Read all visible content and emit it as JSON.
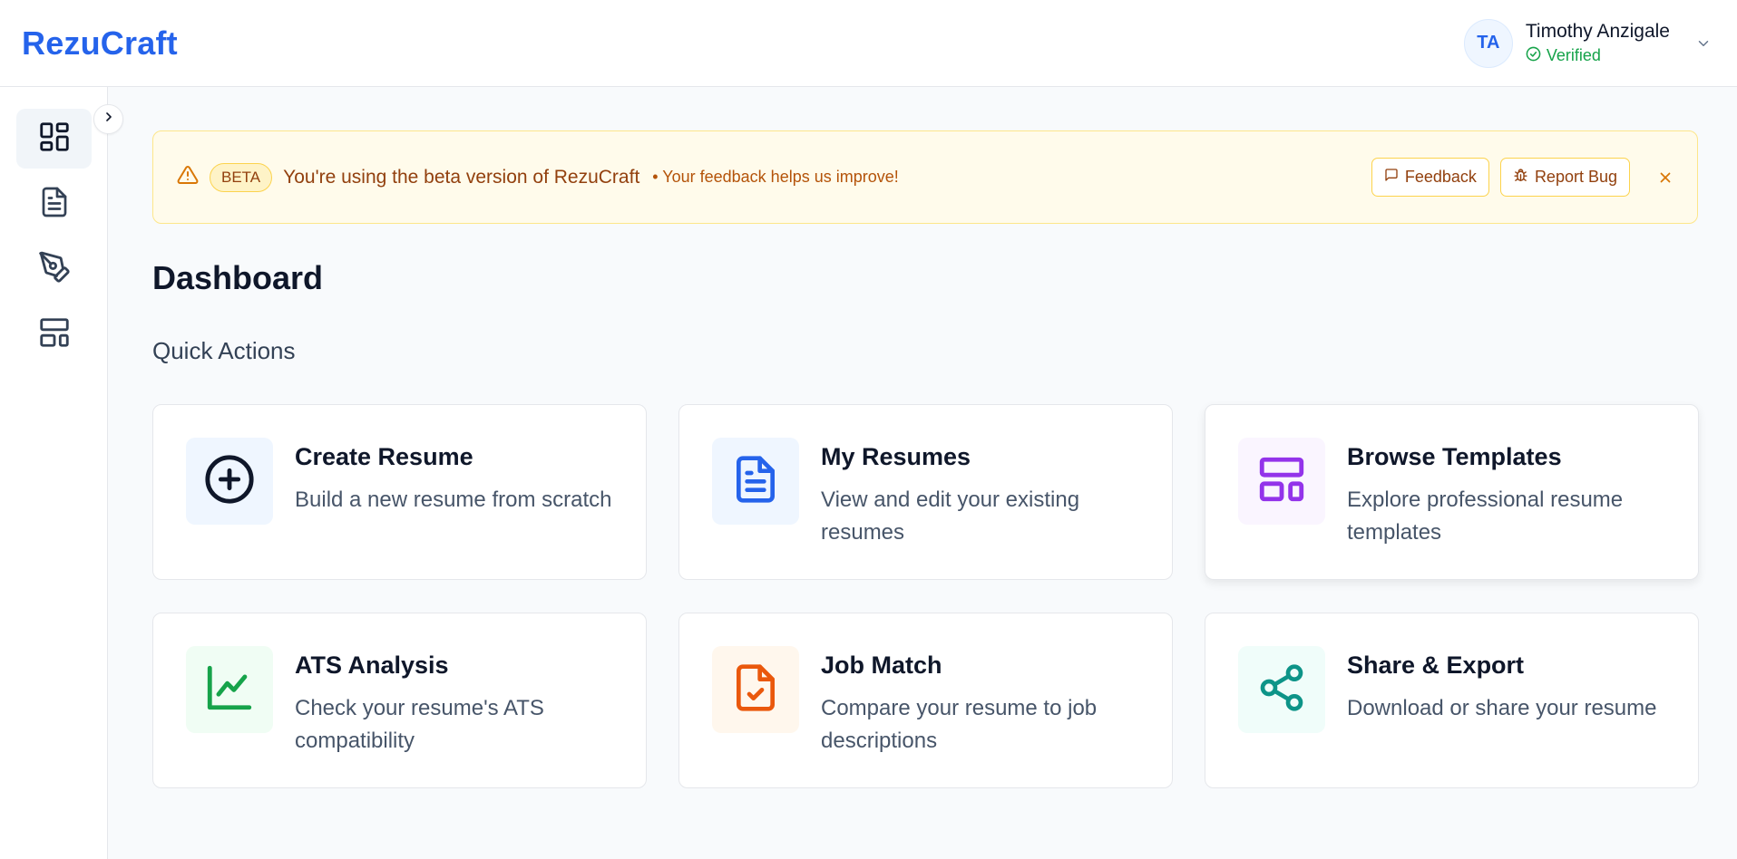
{
  "app": {
    "logo": "RezuCraft"
  },
  "user": {
    "initials": "TA",
    "name": "Timothy Anzigale",
    "status": "Verified"
  },
  "sidebar": {
    "items": [
      {
        "icon": "dashboard-grid-icon",
        "active": true
      },
      {
        "icon": "document-icon",
        "active": false
      },
      {
        "icon": "pen-tool-icon",
        "active": false
      },
      {
        "icon": "layout-template-icon",
        "active": false
      }
    ]
  },
  "banner": {
    "badge": "BETA",
    "title": "You're using the beta version of RezuCraft",
    "subtitle": "• Your feedback helps us improve!",
    "feedback_label": "Feedback",
    "report_label": "Report Bug"
  },
  "page": {
    "title": "Dashboard",
    "section": "Quick Actions"
  },
  "cards": [
    {
      "title": "Create Resume",
      "desc": "Build a new resume from scratch",
      "icon": "plus-circle-icon",
      "color": "#0f172a",
      "bg": "#eff6ff"
    },
    {
      "title": "My Resumes",
      "desc": "View and edit your existing resumes",
      "icon": "file-text-icon",
      "color": "#2563eb",
      "bg": "#eff6ff"
    },
    {
      "title": "Browse Templates",
      "desc": "Explore professional resume templates",
      "icon": "layout-icon",
      "color": "#9333ea",
      "bg": "#faf5ff"
    },
    {
      "title": "ATS Analysis",
      "desc": "Check your resume's ATS compatibility",
      "icon": "chart-line-icon",
      "color": "#16a34a",
      "bg": "#f0fdf4"
    },
    {
      "title": "Job Match",
      "desc": "Compare your resume to job descriptions",
      "icon": "file-check-icon",
      "color": "#ea580c",
      "bg": "#fff7ed"
    },
    {
      "title": "Share & Export",
      "desc": "Download or share your resume",
      "icon": "share-icon",
      "color": "#0d9488",
      "bg": "#f0fdfa"
    }
  ],
  "colors": {
    "brand": "#2563eb",
    "verified": "#16a34a",
    "warning": "#d97706"
  }
}
